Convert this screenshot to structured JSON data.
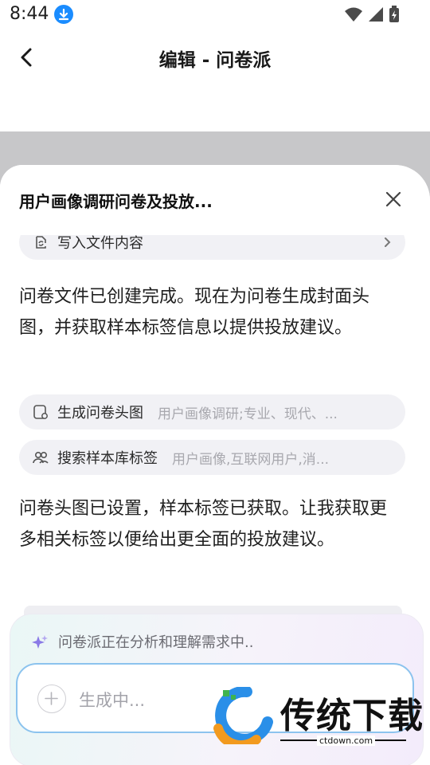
{
  "status_bar": {
    "time": "8:44"
  },
  "nav": {
    "title": "编辑 - 问卷派"
  },
  "sheet": {
    "title": "用户画像调研问卷及投放...",
    "steps": [
      {
        "icon": "sync-document-icon",
        "label": "写入文件内容",
        "detail": ""
      },
      {
        "icon": "image-gear-icon",
        "label": "生成问卷头图",
        "detail": "用户画像调研;专业、现代、..."
      },
      {
        "icon": "users-icon",
        "label": "搜索样本库标签",
        "detail": "用户画像,互联网用户,消..."
      }
    ],
    "messages": [
      "问卷文件已创建完成。现在为问卷生成封面头图，并获取样本标签信息以提供投放建议。",
      "问卷头图已设置，样本标签已获取。让我获取更多相关标签以便给出更全面的投放建议。"
    ]
  },
  "composer": {
    "status": "问卷派正在分析和理解需求中..",
    "placeholder": "生成中..."
  },
  "watermark": {
    "brand": "传统下载",
    "url": "ctdown.com"
  },
  "colors": {
    "accent_blue": "#1a8cff",
    "input_border": "#8cc3ee",
    "overlay": "#c7c7c9"
  }
}
